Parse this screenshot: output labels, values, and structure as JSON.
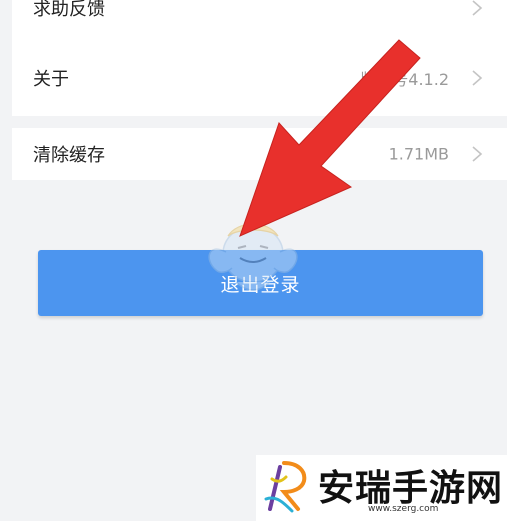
{
  "settings": {
    "items": [
      {
        "label": "求助反馈",
        "value": ""
      },
      {
        "label": "关于",
        "value": "版本号4.1.2"
      },
      {
        "label": "清除缓存",
        "value": "1.71MB"
      }
    ]
  },
  "logout": {
    "label": "退出登录"
  },
  "watermark": {
    "title": "安瑞手游网",
    "url": "www.szerg.com"
  },
  "colors": {
    "accent": "#4c95ef",
    "arrow": "#e8302c",
    "background": "#f2f3f5"
  },
  "icons": [
    "chevron-right-icon",
    "red-arrow-annotation",
    "mascot-watermark",
    "site-logo"
  ]
}
